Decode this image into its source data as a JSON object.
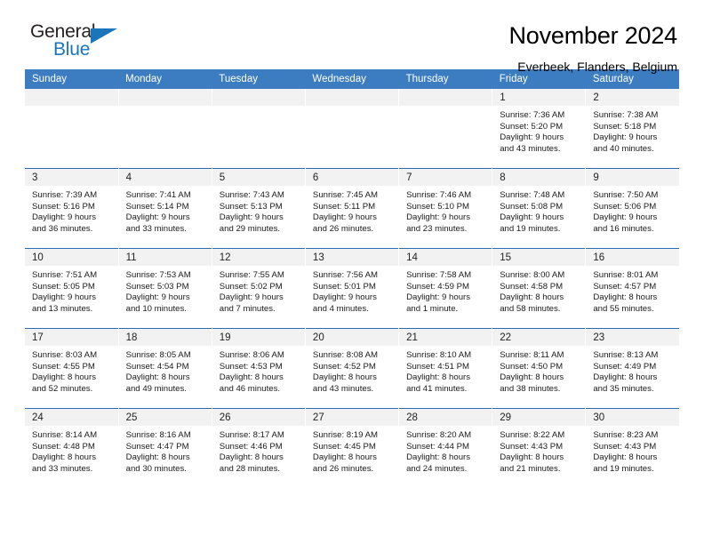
{
  "brand": {
    "name_part1": "General",
    "name_part2": "Blue",
    "triangle_color": "#1b75bb"
  },
  "header": {
    "title": "November 2024",
    "subtitle": "Everbeek, Flanders, Belgium"
  },
  "theme": {
    "header_blue": "#3c7cc0",
    "row_divider_blue": "#2c6cb3",
    "daynum_band_gray": "#f2f2f2"
  },
  "weekday_headers": [
    "Sunday",
    "Monday",
    "Tuesday",
    "Wednesday",
    "Thursday",
    "Friday",
    "Saturday"
  ],
  "weeks": [
    [
      {
        "day": "",
        "sunrise": "",
        "sunset": "",
        "daylight_line1": "",
        "daylight_line2": ""
      },
      {
        "day": "",
        "sunrise": "",
        "sunset": "",
        "daylight_line1": "",
        "daylight_line2": ""
      },
      {
        "day": "",
        "sunrise": "",
        "sunset": "",
        "daylight_line1": "",
        "daylight_line2": ""
      },
      {
        "day": "",
        "sunrise": "",
        "sunset": "",
        "daylight_line1": "",
        "daylight_line2": ""
      },
      {
        "day": "",
        "sunrise": "",
        "sunset": "",
        "daylight_line1": "",
        "daylight_line2": ""
      },
      {
        "day": "1",
        "sunrise": "Sunrise: 7:36 AM",
        "sunset": "Sunset: 5:20 PM",
        "daylight_line1": "Daylight: 9 hours",
        "daylight_line2": "and 43 minutes."
      },
      {
        "day": "2",
        "sunrise": "Sunrise: 7:38 AM",
        "sunset": "Sunset: 5:18 PM",
        "daylight_line1": "Daylight: 9 hours",
        "daylight_line2": "and 40 minutes."
      }
    ],
    [
      {
        "day": "3",
        "sunrise": "Sunrise: 7:39 AM",
        "sunset": "Sunset: 5:16 PM",
        "daylight_line1": "Daylight: 9 hours",
        "daylight_line2": "and 36 minutes."
      },
      {
        "day": "4",
        "sunrise": "Sunrise: 7:41 AM",
        "sunset": "Sunset: 5:14 PM",
        "daylight_line1": "Daylight: 9 hours",
        "daylight_line2": "and 33 minutes."
      },
      {
        "day": "5",
        "sunrise": "Sunrise: 7:43 AM",
        "sunset": "Sunset: 5:13 PM",
        "daylight_line1": "Daylight: 9 hours",
        "daylight_line2": "and 29 minutes."
      },
      {
        "day": "6",
        "sunrise": "Sunrise: 7:45 AM",
        "sunset": "Sunset: 5:11 PM",
        "daylight_line1": "Daylight: 9 hours",
        "daylight_line2": "and 26 minutes."
      },
      {
        "day": "7",
        "sunrise": "Sunrise: 7:46 AM",
        "sunset": "Sunset: 5:10 PM",
        "daylight_line1": "Daylight: 9 hours",
        "daylight_line2": "and 23 minutes."
      },
      {
        "day": "8",
        "sunrise": "Sunrise: 7:48 AM",
        "sunset": "Sunset: 5:08 PM",
        "daylight_line1": "Daylight: 9 hours",
        "daylight_line2": "and 19 minutes."
      },
      {
        "day": "9",
        "sunrise": "Sunrise: 7:50 AM",
        "sunset": "Sunset: 5:06 PM",
        "daylight_line1": "Daylight: 9 hours",
        "daylight_line2": "and 16 minutes."
      }
    ],
    [
      {
        "day": "10",
        "sunrise": "Sunrise: 7:51 AM",
        "sunset": "Sunset: 5:05 PM",
        "daylight_line1": "Daylight: 9 hours",
        "daylight_line2": "and 13 minutes."
      },
      {
        "day": "11",
        "sunrise": "Sunrise: 7:53 AM",
        "sunset": "Sunset: 5:03 PM",
        "daylight_line1": "Daylight: 9 hours",
        "daylight_line2": "and 10 minutes."
      },
      {
        "day": "12",
        "sunrise": "Sunrise: 7:55 AM",
        "sunset": "Sunset: 5:02 PM",
        "daylight_line1": "Daylight: 9 hours",
        "daylight_line2": "and 7 minutes."
      },
      {
        "day": "13",
        "sunrise": "Sunrise: 7:56 AM",
        "sunset": "Sunset: 5:01 PM",
        "daylight_line1": "Daylight: 9 hours",
        "daylight_line2": "and 4 minutes."
      },
      {
        "day": "14",
        "sunrise": "Sunrise: 7:58 AM",
        "sunset": "Sunset: 4:59 PM",
        "daylight_line1": "Daylight: 9 hours",
        "daylight_line2": "and 1 minute."
      },
      {
        "day": "15",
        "sunrise": "Sunrise: 8:00 AM",
        "sunset": "Sunset: 4:58 PM",
        "daylight_line1": "Daylight: 8 hours",
        "daylight_line2": "and 58 minutes."
      },
      {
        "day": "16",
        "sunrise": "Sunrise: 8:01 AM",
        "sunset": "Sunset: 4:57 PM",
        "daylight_line1": "Daylight: 8 hours",
        "daylight_line2": "and 55 minutes."
      }
    ],
    [
      {
        "day": "17",
        "sunrise": "Sunrise: 8:03 AM",
        "sunset": "Sunset: 4:55 PM",
        "daylight_line1": "Daylight: 8 hours",
        "daylight_line2": "and 52 minutes."
      },
      {
        "day": "18",
        "sunrise": "Sunrise: 8:05 AM",
        "sunset": "Sunset: 4:54 PM",
        "daylight_line1": "Daylight: 8 hours",
        "daylight_line2": "and 49 minutes."
      },
      {
        "day": "19",
        "sunrise": "Sunrise: 8:06 AM",
        "sunset": "Sunset: 4:53 PM",
        "daylight_line1": "Daylight: 8 hours",
        "daylight_line2": "and 46 minutes."
      },
      {
        "day": "20",
        "sunrise": "Sunrise: 8:08 AM",
        "sunset": "Sunset: 4:52 PM",
        "daylight_line1": "Daylight: 8 hours",
        "daylight_line2": "and 43 minutes."
      },
      {
        "day": "21",
        "sunrise": "Sunrise: 8:10 AM",
        "sunset": "Sunset: 4:51 PM",
        "daylight_line1": "Daylight: 8 hours",
        "daylight_line2": "and 41 minutes."
      },
      {
        "day": "22",
        "sunrise": "Sunrise: 8:11 AM",
        "sunset": "Sunset: 4:50 PM",
        "daylight_line1": "Daylight: 8 hours",
        "daylight_line2": "and 38 minutes."
      },
      {
        "day": "23",
        "sunrise": "Sunrise: 8:13 AM",
        "sunset": "Sunset: 4:49 PM",
        "daylight_line1": "Daylight: 8 hours",
        "daylight_line2": "and 35 minutes."
      }
    ],
    [
      {
        "day": "24",
        "sunrise": "Sunrise: 8:14 AM",
        "sunset": "Sunset: 4:48 PM",
        "daylight_line1": "Daylight: 8 hours",
        "daylight_line2": "and 33 minutes."
      },
      {
        "day": "25",
        "sunrise": "Sunrise: 8:16 AM",
        "sunset": "Sunset: 4:47 PM",
        "daylight_line1": "Daylight: 8 hours",
        "daylight_line2": "and 30 minutes."
      },
      {
        "day": "26",
        "sunrise": "Sunrise: 8:17 AM",
        "sunset": "Sunset: 4:46 PM",
        "daylight_line1": "Daylight: 8 hours",
        "daylight_line2": "and 28 minutes."
      },
      {
        "day": "27",
        "sunrise": "Sunrise: 8:19 AM",
        "sunset": "Sunset: 4:45 PM",
        "daylight_line1": "Daylight: 8 hours",
        "daylight_line2": "and 26 minutes."
      },
      {
        "day": "28",
        "sunrise": "Sunrise: 8:20 AM",
        "sunset": "Sunset: 4:44 PM",
        "daylight_line1": "Daylight: 8 hours",
        "daylight_line2": "and 24 minutes."
      },
      {
        "day": "29",
        "sunrise": "Sunrise: 8:22 AM",
        "sunset": "Sunset: 4:43 PM",
        "daylight_line1": "Daylight: 8 hours",
        "daylight_line2": "and 21 minutes."
      },
      {
        "day": "30",
        "sunrise": "Sunrise: 8:23 AM",
        "sunset": "Sunset: 4:43 PM",
        "daylight_line1": "Daylight: 8 hours",
        "daylight_line2": "and 19 minutes."
      }
    ]
  ]
}
